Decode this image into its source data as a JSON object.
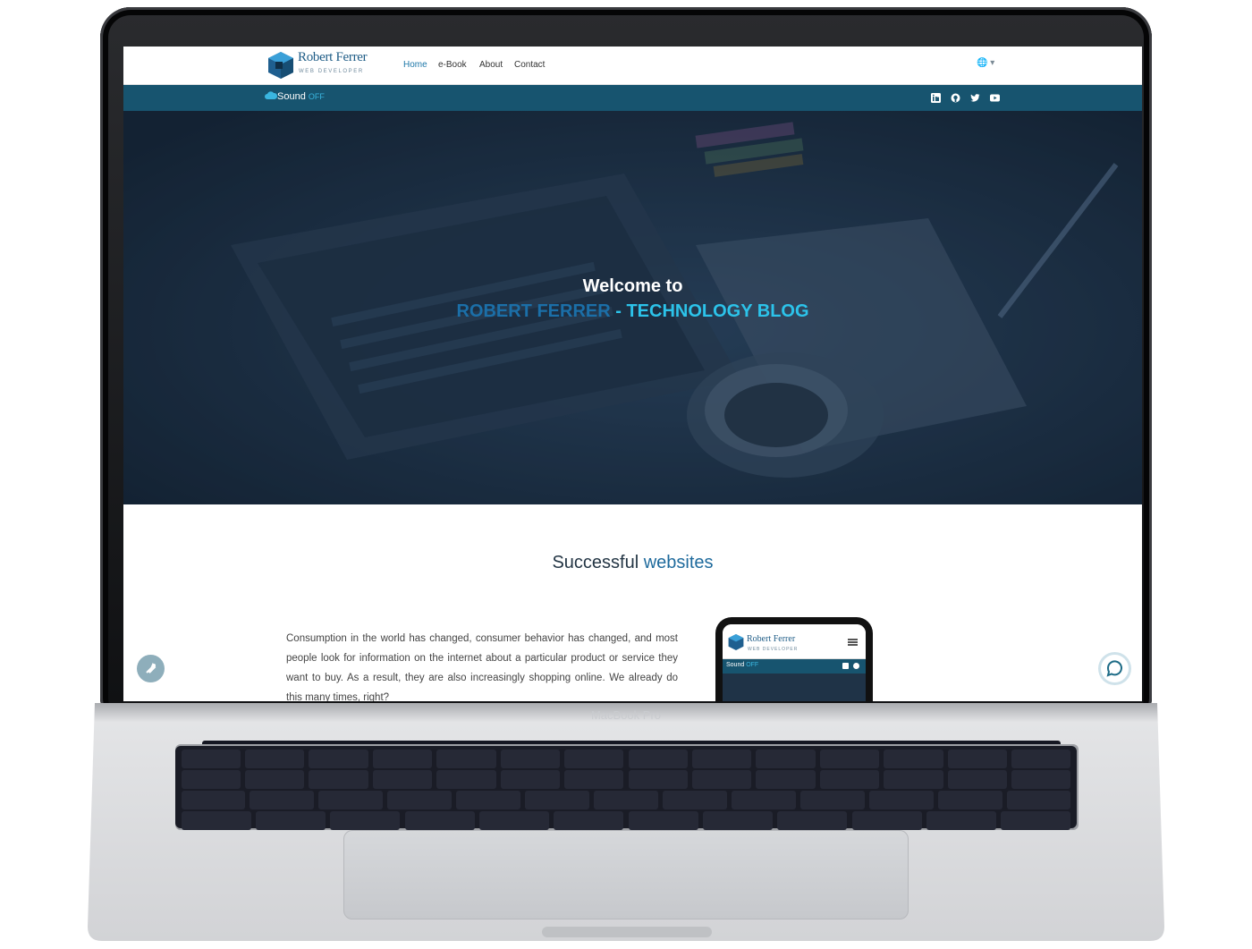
{
  "header": {
    "logo_title": "Robert Ferrer",
    "logo_subtitle": "WEB DEVELOPER",
    "nav": [
      "Home",
      "e-Book",
      "About",
      "Contact"
    ],
    "language": "🌐 ▾"
  },
  "subbar": {
    "sound_label": "Sound",
    "sound_state": "OFF",
    "social_icons": [
      "linkedin-icon",
      "github-icon",
      "twitter-icon",
      "youtube-icon"
    ]
  },
  "hero": {
    "title": "Welcome to",
    "name": "ROBERT FERRER",
    "separator": " - ",
    "tagline": "TECHNOLOGY BLOG"
  },
  "section": {
    "title_plain": "Successful ",
    "title_highlight": "websites",
    "paragraph": "Consumption in the world has changed, consumer behavior has changed, and most people look for information on the internet about a particular product or service they want to buy. As a result, they are also increasingly shopping online. We already do this many times, right?"
  },
  "phone": {
    "logo_title": "Robert Ferrer",
    "logo_subtitle": "WEB DEVELOPER",
    "sound_label": "Sound",
    "sound_state": "OFF"
  },
  "device_label": "MacBook Pro",
  "colors": {
    "primary": "#17546f",
    "accent": "#2cc3ea",
    "link_active": "#1d77a8"
  }
}
